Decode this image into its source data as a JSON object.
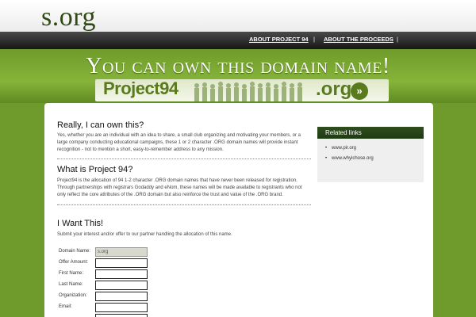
{
  "header": {
    "logo": "s.org"
  },
  "nav": {
    "items": [
      {
        "label": "ABOUT PROJECT 94"
      },
      {
        "label": "ABOUT THE PROCEEDS"
      }
    ],
    "separator": "|"
  },
  "banner": {
    "title": "You can own this domain name!",
    "brand_left": "Project94",
    "brand_right": ".org",
    "arrow": "»"
  },
  "main": {
    "sections": [
      {
        "title": "Really, I can own this?",
        "lines": [
          "Yes, whether you are an individual with an idea to share, a small club organizing and motivating your members, or a",
          "large company conducting educational campaigns, these 1 or 2 character .ORG domain names will provide instant",
          "recognition - not to mention a short, easy-to-remember address to any mission."
        ]
      },
      {
        "title": "What is Project 94?",
        "lines": [
          "Project94 is the allocation of 94 1-2 character .ORG domain names that have never been released for registration.",
          "Through partnerships with registrars Godaddy and eNom, these names will be made available to registrants who not",
          "only reflect the core attributes of the .ORG domain but also reinforce the trust and value of the .ORG brand."
        ]
      },
      {
        "title": "I Want This!",
        "lines": [
          "Submit your interest and/or offer to our partner handling the allocation of this name."
        ]
      }
    ],
    "form": {
      "fields": [
        {
          "label": "Domain Name:",
          "value": "s.org"
        },
        {
          "label": "Offer Amount:",
          "value": ""
        },
        {
          "label": "First Name:",
          "value": ""
        },
        {
          "label": "Last Name:",
          "value": ""
        },
        {
          "label": "Organization:",
          "value": ""
        },
        {
          "label": "Email:",
          "value": ""
        }
      ]
    }
  },
  "sidebar": {
    "title": "Related links",
    "links": [
      {
        "label": "www.pir.org"
      },
      {
        "label": "www.whyichose.org"
      }
    ]
  },
  "colors": {
    "accent_green": "#6f9a2c",
    "nav_dark": "#1e1e1e",
    "sidebar_header": "#2f4f1e"
  }
}
